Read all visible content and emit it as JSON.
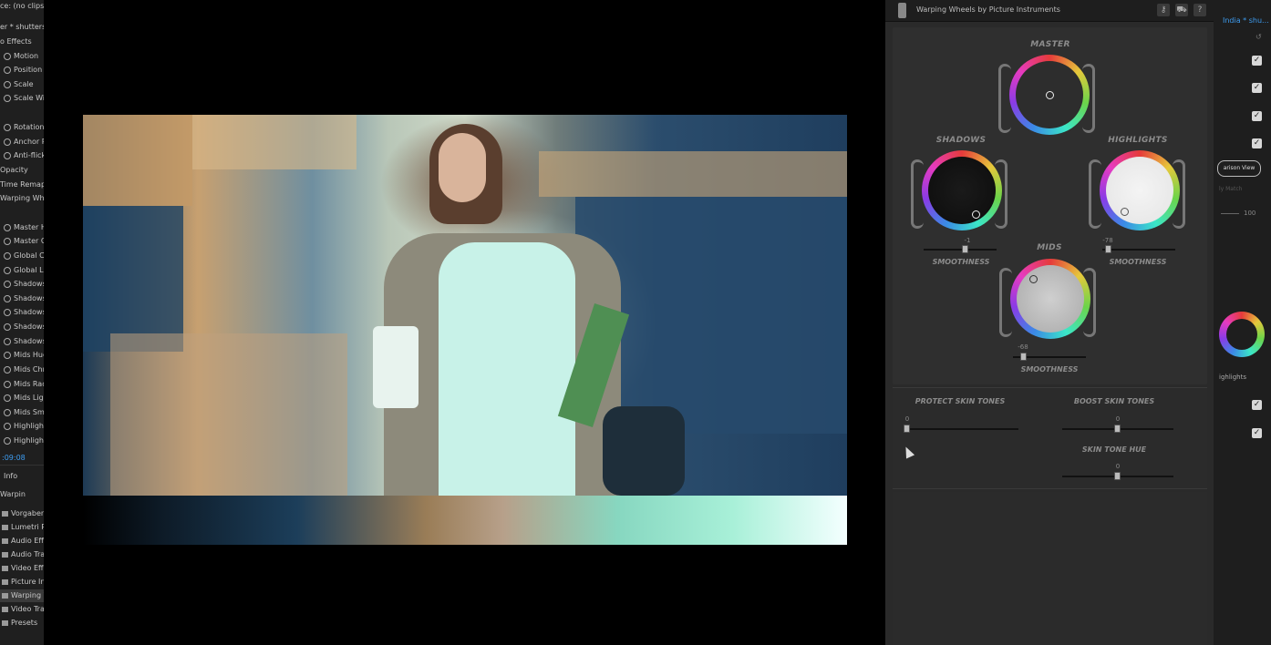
{
  "left_panel": {
    "rows": [
      {
        "text": "ce: (no clips)",
        "icon": "none"
      },
      {
        "text": "er * shutterstoc",
        "icon": "none"
      },
      {
        "text": "o Effects",
        "icon": "none"
      },
      {
        "text": "Motion",
        "icon": "motion-icon"
      },
      {
        "text": "Position",
        "icon": "stopwatch-icon"
      },
      {
        "text": "Scale",
        "icon": "stopwatch-icon"
      },
      {
        "text": "Scale Width",
        "icon": "stopwatch-icon"
      },
      {
        "text": "Rotation",
        "icon": "stopwatch-icon"
      },
      {
        "text": "Anchor Point",
        "icon": "stopwatch-icon"
      },
      {
        "text": "Anti-flicker",
        "icon": "stopwatch-icon"
      },
      {
        "text": "Opacity",
        "icon": "none"
      },
      {
        "text": "Time Remapping",
        "icon": "none"
      },
      {
        "text": "Warping Wheels",
        "icon": "none"
      },
      {
        "text": "Master Hue",
        "icon": "stopwatch-icon"
      },
      {
        "text": "Master Chroma",
        "icon": "stopwatch-icon"
      },
      {
        "text": "Global Chroma",
        "icon": "stopwatch-icon"
      },
      {
        "text": "Global Luma",
        "icon": "stopwatch-icon"
      },
      {
        "text": "Shadows",
        "icon": "stopwatch-icon"
      },
      {
        "text": "Shadows",
        "icon": "stopwatch-icon"
      },
      {
        "text": "Shadows",
        "icon": "stopwatch-icon"
      },
      {
        "text": "Shadows",
        "icon": "stopwatch-icon"
      },
      {
        "text": "Shadows",
        "icon": "stopwatch-icon"
      },
      {
        "text": "Mids Hue",
        "icon": "stopwatch-icon"
      },
      {
        "text": "Mids Chroma",
        "icon": "stopwatch-icon"
      },
      {
        "text": "Mids Radius",
        "icon": "stopwatch-icon"
      },
      {
        "text": "Mids Light",
        "icon": "stopwatch-icon"
      },
      {
        "text": "Mids Smooth",
        "icon": "stopwatch-icon"
      },
      {
        "text": "Highlights",
        "icon": "stopwatch-icon"
      },
      {
        "text": "Highlights",
        "icon": "stopwatch-icon"
      }
    ],
    "timecode": ":09:08",
    "tab_info": "Info",
    "search_value": "Warpin",
    "tree": [
      {
        "text": "Vorgaben",
        "icon": "folder-icon"
      },
      {
        "text": "Lumetri Presets",
        "icon": "folder-icon"
      },
      {
        "text": "Audio Effects",
        "icon": "folder-icon"
      },
      {
        "text": "Audio Transitions",
        "icon": "folder-icon"
      },
      {
        "text": "Video Effects",
        "icon": "folder-icon"
      },
      {
        "text": "Picture Instruments",
        "icon": "folder-icon"
      },
      {
        "text": "Warping Wheels",
        "icon": "effect-icon"
      },
      {
        "text": "Video Transitions",
        "icon": "folder-icon"
      },
      {
        "text": "Presets",
        "icon": "folder-icon"
      }
    ]
  },
  "plugin": {
    "title": "Warping Wheels by Picture Instruments",
    "header_buttons": [
      {
        "name": "key-icon",
        "glyph": "⚷"
      },
      {
        "name": "cart-icon",
        "glyph": "⛟"
      },
      {
        "name": "help-icon",
        "glyph": "?"
      }
    ],
    "master": {
      "label": "MASTER"
    },
    "shadows": {
      "label": "SHADOWS",
      "value": "-1",
      "smooth_label": "SMOOTHNESS"
    },
    "highlights": {
      "label": "HIGHLIGHTS",
      "value": "-78",
      "smooth_label": "SMOOTHNESS"
    },
    "mids": {
      "label": "MIDS",
      "value": "-68",
      "smooth_label": "SMOOTHNESS"
    },
    "protect_skin": {
      "label": "PROTECT SKIN TONES",
      "value": "0"
    },
    "boost_skin": {
      "label": "BOOST SKIN TONES",
      "value": "0"
    },
    "skin_hue": {
      "label": "SKIN TONE HUE",
      "value": "0"
    }
  },
  "far_right": {
    "title": "India * shu...",
    "compare_label": "arison View",
    "match_label": "ly Match",
    "value_100": "100",
    "highlights_label": "ighlights"
  }
}
